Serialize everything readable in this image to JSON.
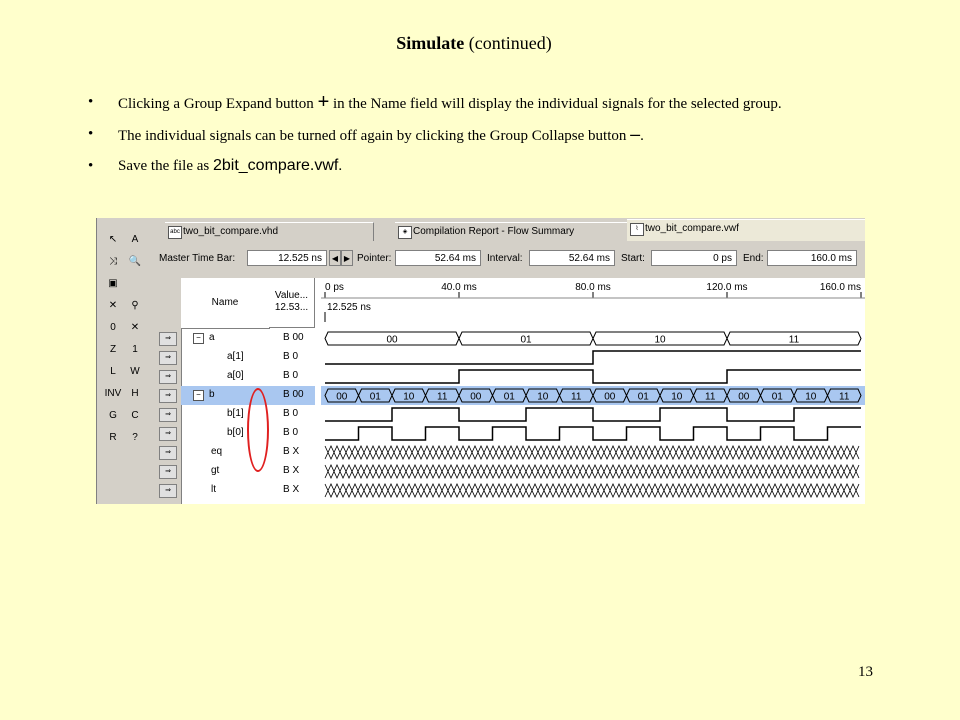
{
  "slide": {
    "title_bold": "Simulate",
    "title_rest": "(continued)",
    "bullet_char": "•",
    "bullets": [
      {
        "pre": "Clicking a Group Expand button ",
        "symbol": "+",
        "post": " in the Name field will display the individual signals for the selected group."
      },
      {
        "pre": "The individual signals can be turned off again by clicking the Group Collapse button ",
        "symbol": "–",
        "post": "."
      },
      {
        "pre": "Save the file as ",
        "symbol": "2bit_compare.vwf",
        "post": "."
      }
    ],
    "page_number": "13"
  },
  "tabs": [
    {
      "label": "two_bit_compare.vhd",
      "icon": "vhd-file-icon"
    },
    {
      "label": "Compilation Report - Flow Summary",
      "icon": "report-icon"
    },
    {
      "label": "two_bit_compare.vwf",
      "icon": "waveform-file-icon"
    }
  ],
  "infobar": {
    "master_label": "Master Time Bar:",
    "master_value": "12.525 ns",
    "pointer_label": "Pointer:",
    "pointer_value": "52.64 ms",
    "interval_label": "Interval:",
    "interval_value": "52.64 ms",
    "start_label": "Start:",
    "start_value": "0 ps",
    "end_label": "End:",
    "end_value": "160.0 ms"
  },
  "toolbar": {
    "tools": [
      "↖",
      "A",
      "⤨",
      "🔍",
      "▣",
      "⚲",
      "✕",
      "✕",
      "0",
      "1",
      "Z",
      "W",
      "L",
      "H",
      "INV",
      "C",
      "G",
      "?",
      "R"
    ]
  },
  "columns": {
    "name": "Name",
    "value_line1": "Value...",
    "value_line2": "12.53..."
  },
  "time_axis": {
    "ticks": [
      "0 ps",
      "40.0 ms",
      "80.0 ms",
      "120.0 ms",
      "160.0 ms"
    ],
    "cursor_label": "12.525 ns"
  },
  "signals": [
    {
      "name": "a",
      "value": "B 00",
      "group": true,
      "expanded": true,
      "wave": "bus",
      "bus_values": [
        "00",
        "01",
        "10",
        "11"
      ]
    },
    {
      "name": "a[1]",
      "value": "B 0",
      "group": false,
      "wave": "bit",
      "levels": [
        0,
        0,
        1,
        1
      ]
    },
    {
      "name": "a[0]",
      "value": "B 0",
      "group": false,
      "wave": "bit",
      "levels": [
        0,
        1,
        0,
        1
      ]
    },
    {
      "name": "b",
      "value": "B 00",
      "group": true,
      "expanded": true,
      "selected": true,
      "wave": "bus",
      "bus_values": [
        "00",
        "01",
        "10",
        "11",
        "00",
        "01",
        "10",
        "11",
        "00",
        "01",
        "10",
        "11",
        "00",
        "01",
        "10",
        "11"
      ]
    },
    {
      "name": "b[1]",
      "value": "B 0",
      "group": false,
      "wave": "bit",
      "levels": [
        0,
        0,
        1,
        1,
        0,
        0,
        1,
        1,
        0,
        0,
        1,
        1,
        0,
        0,
        1,
        1
      ]
    },
    {
      "name": "b[0]",
      "value": "B 0",
      "group": false,
      "wave": "bit",
      "levels": [
        0,
        1,
        0,
        1,
        0,
        1,
        0,
        1,
        0,
        1,
        0,
        1,
        0,
        1,
        0,
        1
      ]
    },
    {
      "name": "eq",
      "value": "B X",
      "group": false,
      "wave": "undefined"
    },
    {
      "name": "gt",
      "value": "B X",
      "group": false,
      "wave": "undefined"
    },
    {
      "name": "lt",
      "value": "B X",
      "group": false,
      "wave": "undefined"
    }
  ],
  "colors": {
    "slide_bg": "#FFFFCC",
    "selected_row": "#A9C7F0",
    "ring": "#E02020"
  }
}
